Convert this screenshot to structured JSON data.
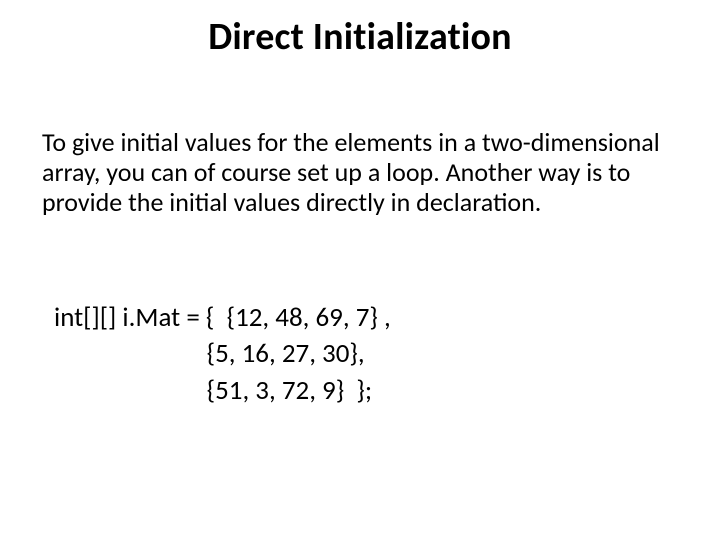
{
  "title": "Direct Initialization",
  "paragraph": "To give initial values for the elements in a two-dimensional array, you can of course set up a loop. Another way is to provide the initial values directly in declaration.",
  "code_block": "int[][] i.Mat = {  {12, 48, 69, 7} ,\n                         {5, 16, 27, 30},\n                         {51, 3, 72, 9}  };"
}
